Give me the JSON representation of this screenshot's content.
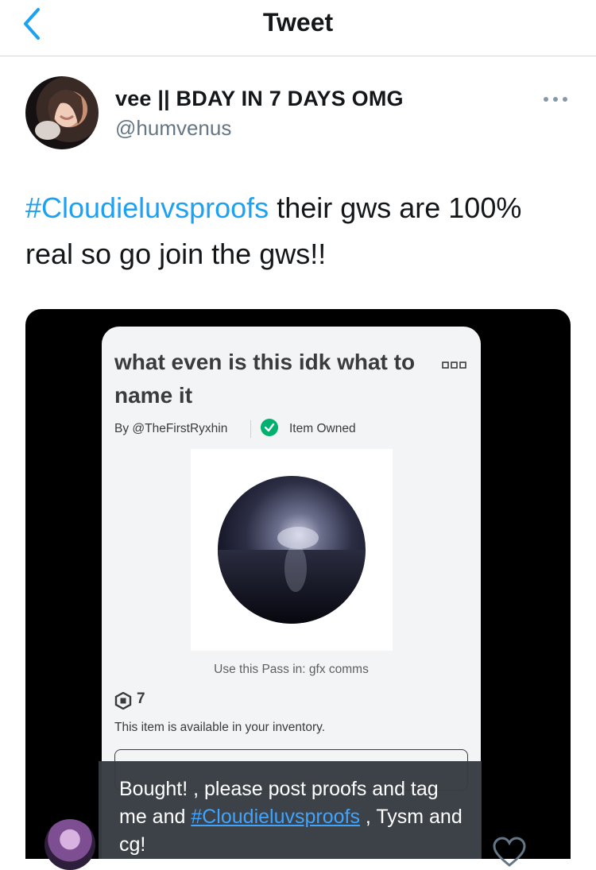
{
  "header": {
    "title": "Tweet",
    "back_icon": "chevron-left-icon",
    "accent": "#1da1f2"
  },
  "author": {
    "name": "vee || BDAY IN 7 DAYS OMG",
    "handle": "@humvenus"
  },
  "tweet": {
    "hashtag": "#Cloudieluvsproofs",
    "text": " their gws are 100% real so go join the gws!!"
  },
  "embedded_card": {
    "title": "what even is this idk what to name it",
    "byline": "By @TheFirstRyxhin",
    "status": "Item Owned",
    "use_pass": "Use this Pass in: gfx comms",
    "price": "7",
    "availability": "This item is available in your inventory."
  },
  "caption": {
    "text_before": "Bought! , please post proofs and tag me and ",
    "hashtag": "#Cloudieluvsproofs",
    "text_after": " , Tysm and cg!"
  }
}
